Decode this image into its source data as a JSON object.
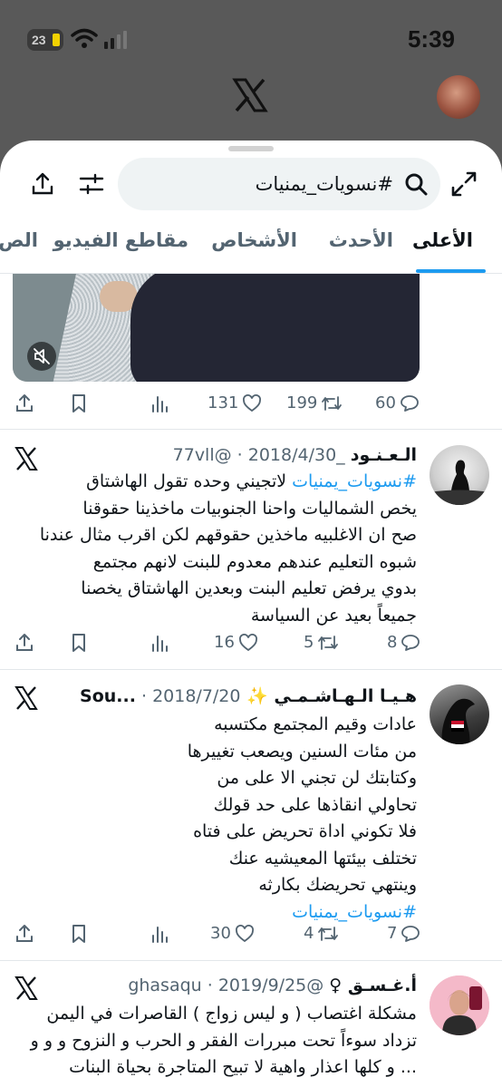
{
  "status_bar": {
    "time": "5:39",
    "battery": "23"
  },
  "search": {
    "query": "#نسويات_يمنيات"
  },
  "tabs": [
    {
      "label": "الأعلى"
    },
    {
      "label": "الأحدث"
    },
    {
      "label": "الأشخاص"
    },
    {
      "label": "مقاطع الفيديو"
    },
    {
      "label": "الص"
    }
  ],
  "top_post": {
    "replies": "60",
    "reposts": "199",
    "likes": "131"
  },
  "tweets": [
    {
      "name": "الـعـنـود",
      "meta": "_77vll@ · 2018/4/30",
      "hashtag": "#نسويات_يمنيات",
      "lines": [
        "لاتجيني وحده تقول الهاشتاق",
        "يخص الشماليات واحنا الجنوبيات ماخذينا حقوقنا",
        "صح ان الاغلبيه ماخذين حقوقهم لكن اقرب مثال عندنا",
        "شبوه التعليم عندهم معدوم للبنت لانهم مجتمع",
        "بدوي يرفض تعليم البنت وبعدين الهاشتاق يخصنا",
        "جميعاً بعيد عن السياسة"
      ],
      "replies": "8",
      "reposts": "5",
      "likes": "16"
    },
    {
      "name": "هـيـا الـهـاشـمـي ✨ Sou...",
      "meta": "· 2018/7/20",
      "lines": [
        "عادات وقيم المجتمع مكتسبه",
        "من مئات السنين ويصعب تغييرها",
        "وكتابتك لن تجني الا على من",
        "تحاولي انقاذها على حد قولك",
        "فلا تكوني اداة تحريض على فتاه",
        "تختلف بيئتها المعيشيه عنك",
        "وينتهي تحريضك بكارثه"
      ],
      "hashtag": "#نسويات_يمنيات",
      "replies": "7",
      "reposts": "4",
      "likes": "30"
    },
    {
      "name": "أ.غـسـق ♀",
      "meta": "@ghasaqu · 2019/9/25",
      "lines": [
        "مشكلة اغتصاب ( و ليس زواج ) القاصرات في اليمن",
        "تزداد سوءاً تحت مبررات الفقر و الحرب و النزوح و و و",
        "... و كلها اعذار واهية لا تبيح المتاجرة بحياة البنات"
      ]
    }
  ],
  "colors": {
    "accent": "#1d9bf0",
    "text": "#0f1419",
    "muted": "#536471"
  }
}
